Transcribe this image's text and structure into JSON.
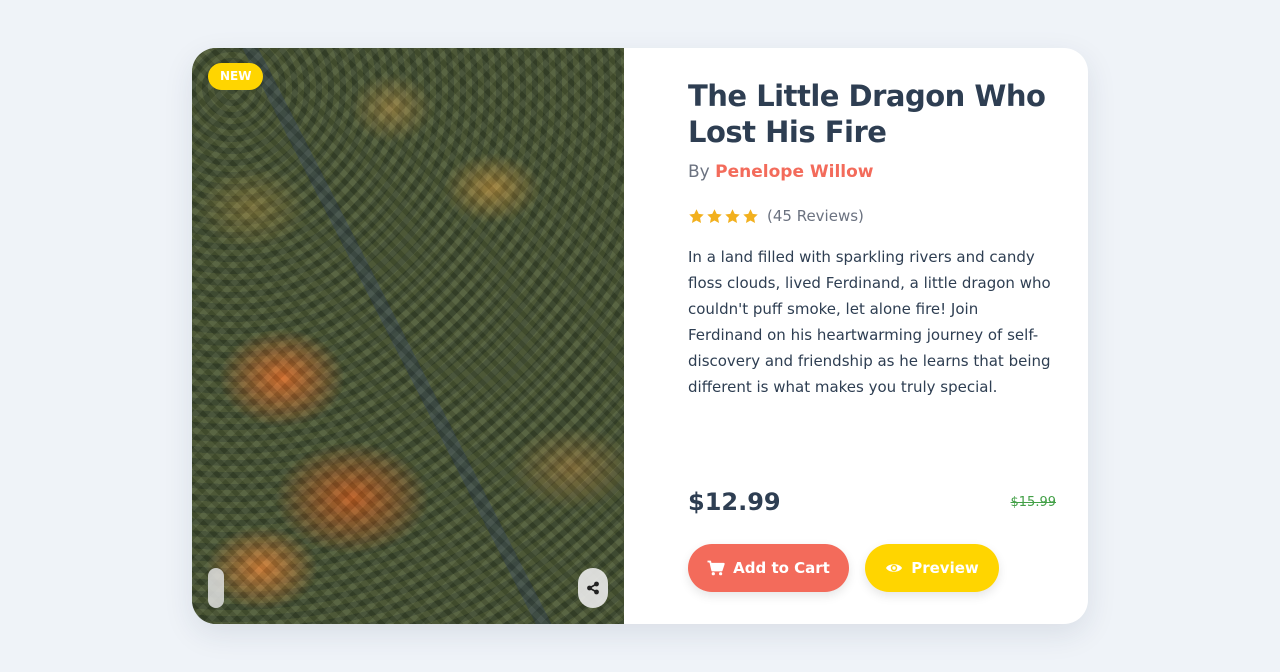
{
  "product": {
    "badge": "NEW",
    "title": "The Little Dragon Who Lost His Fire",
    "by_label": "By",
    "author": "Penelope Willow",
    "rating": 4,
    "rating_max": 4,
    "reviews": "(45 Reviews)",
    "description": "In a land filled with sparkling rivers and candy floss clouds, lived Ferdinand, a little dragon who couldn't puff smoke, let alone fire! Join Ferdinand on his heartwarming journey of self-discovery and friendship as he learns that being different is what makes you truly special.",
    "price": "$12.99",
    "old_price": "$15.99"
  },
  "actions": {
    "add_to_cart": "Add to Cart",
    "preview": "Preview"
  },
  "icons": {
    "share": "share-icon",
    "cart": "cart-icon",
    "eye": "eye-icon",
    "star": "star-icon"
  },
  "colors": {
    "page_bg": "#eff3f8",
    "accent_coral": "#f36b5b",
    "accent_yellow": "#ffd500",
    "star": "#f2b01e",
    "old_price": "#43a047",
    "text_dark": "#2e3e52"
  }
}
